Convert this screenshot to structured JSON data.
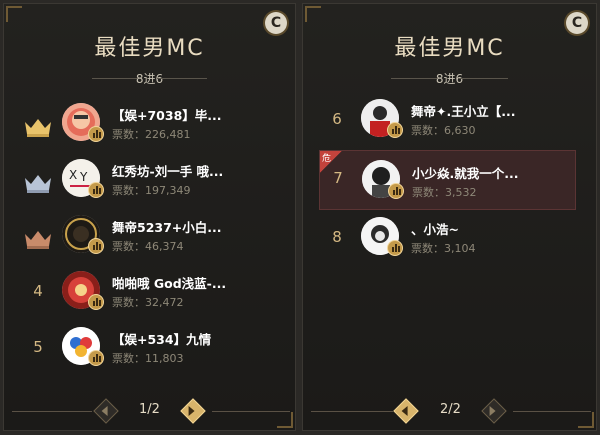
{
  "panels": [
    {
      "title": "最佳男MC",
      "subtitle": "8进6",
      "corner_button": "C",
      "pager": {
        "label": "1/2"
      },
      "entries": [
        {
          "rank": "1",
          "rank_display": "crown-gold",
          "name": "【娱+7038】毕...",
          "votes": "票数：226,481",
          "danger": false
        },
        {
          "rank": "2",
          "rank_display": "crown-silver",
          "name": "红秀坊-刘一手 哦...",
          "votes": "票数：197,349",
          "danger": false
        },
        {
          "rank": "3",
          "rank_display": "crown-bronze",
          "name": "舞帝5237+小白...",
          "votes": "票数：46,374",
          "danger": false
        },
        {
          "rank": "4",
          "rank_display": "number",
          "name": "啪啪哦 God浅蓝-...",
          "votes": "票数：32,472",
          "danger": false
        },
        {
          "rank": "5",
          "rank_display": "number",
          "name": "【娱+534】九情",
          "votes": "票数：11,803",
          "danger": false
        }
      ]
    },
    {
      "title": "最佳男MC",
      "subtitle": "8进6",
      "corner_button": "C",
      "pager": {
        "label": "2/2"
      },
      "entries": [
        {
          "rank": "6",
          "rank_display": "number",
          "name": "舞帝✦.王小立【...",
          "votes": "票数：6,630",
          "danger": false
        },
        {
          "rank": "7",
          "rank_display": "number",
          "name": "小少焱.就我一个...",
          "votes": "票数：3,532",
          "danger": true,
          "danger_label": "危"
        },
        {
          "rank": "8",
          "rank_display": "number",
          "name": "、小浩~",
          "votes": "票数：3,104",
          "danger": false
        }
      ]
    }
  ],
  "colors": {
    "crown_gold": "#e8c36b",
    "crown_silver": "#b8c4d6",
    "crown_bronze": "#c98b6a",
    "danger": "#c3433c",
    "highlight_row": "#3a2626"
  }
}
